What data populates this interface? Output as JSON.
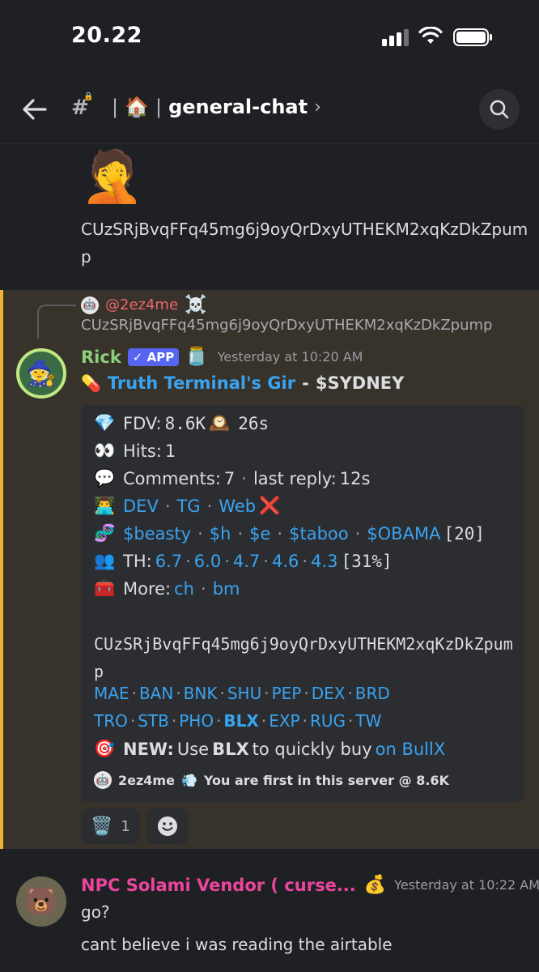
{
  "status": {
    "time": "20.22"
  },
  "header": {
    "channel_name": "general-chat",
    "channel_emoji": "🏠",
    "separator": "|",
    "chevron": "›"
  },
  "previous_message": {
    "emoji": "🤦",
    "text": "CUzSRjBvqFFq45mg6j9oyQrDxyUTHEKM2xqKzDkZpump"
  },
  "reply": {
    "user": "@2ez4me",
    "decoration": "☠️",
    "text": "CUzSRjBvqFFq45mg6j9oyQrDxyUTHEKM2xqKzDkZpump"
  },
  "message": {
    "author": "Rick",
    "app_badge": "✓ APP",
    "author_emoji": "🫙",
    "timestamp": "Yesterday at 10:20 AM",
    "title_icon": "💊",
    "title_link": "Truth Terminal's Gir",
    "title_dash": "-",
    "title_ticker": "$SYDNEY"
  },
  "embed": {
    "fdv_label": "FDV:",
    "fdv_value": "8.6K",
    "age_value": "26s",
    "hits_label": "Hits:",
    "hits_value": "1",
    "comments_label": "Comments:",
    "comments_value": "7",
    "last_reply_label": "last reply:",
    "last_reply_value": "12s",
    "dev_links": [
      "DEV",
      "TG",
      "Web"
    ],
    "related": [
      "$beasty",
      "$h",
      "$e",
      "$taboo",
      "$OBAMA"
    ],
    "related_count": "[20]",
    "th_label": "TH:",
    "th_values": [
      "6.7",
      "6.0",
      "4.7",
      "4.6",
      "4.3"
    ],
    "th_pct": "[31%]",
    "more_label": "More:",
    "more_links": [
      "ch",
      "bm"
    ],
    "ca": "CUzSRjBvqFFq45mg6j9oyQrDxyUTHEKM2xqKzDkZpump",
    "tags_row1": [
      "MAE",
      "BAN",
      "BNK",
      "SHU",
      "PEP",
      "DEX",
      "BRD"
    ],
    "tags_row2": [
      "TRO",
      "STB",
      "PHO",
      "BLX",
      "EXP",
      "RUG",
      "TW"
    ],
    "new_label": "NEW:",
    "new_text_1": "Use",
    "new_bold": "BLX",
    "new_text_2": "to quickly buy",
    "new_link": "on BullX",
    "footer_user": "2ez4me",
    "footer_text": "You are first in this server @ 8.6K"
  },
  "reactions": [
    {
      "emoji": "🗑️",
      "count": "1"
    },
    {
      "emoji": "☻",
      "count": ""
    }
  ],
  "next_message": {
    "author": "NPC Solami Vendor ( curse...",
    "author_emoji": "💰",
    "timestamp": "Yesterday at 10:22 AM",
    "line1": "go?",
    "line2": "cant believe i was reading the airtable"
  },
  "colors": {
    "accent_link": "#3aa3f0",
    "author_green": "#8bd07c",
    "mention_red": "#eb6570",
    "npc_pink": "#eb459e",
    "highlight_bar": "#f0b232",
    "app_badge": "#5865f2"
  }
}
